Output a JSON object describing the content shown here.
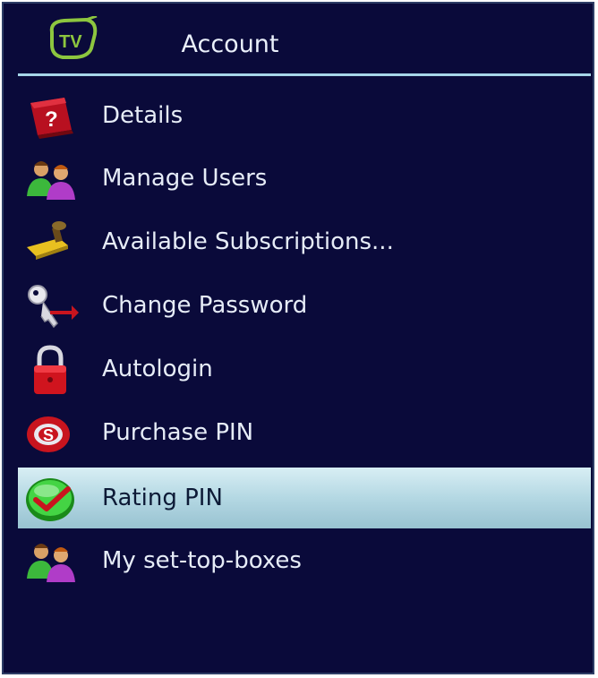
{
  "header": {
    "logo_text": "TV",
    "title": "Account"
  },
  "menu": {
    "selected_index": 6,
    "items": [
      {
        "label": "Details",
        "icon": "question-box-icon"
      },
      {
        "label": "Manage Users",
        "icon": "users-icon"
      },
      {
        "label": "Available Subscriptions...",
        "icon": "stamp-icon"
      },
      {
        "label": "Change Password",
        "icon": "key-icon"
      },
      {
        "label": "Autologin",
        "icon": "padlock-icon"
      },
      {
        "label": "Purchase PIN",
        "icon": "coin-icon"
      },
      {
        "label": "Rating PIN",
        "icon": "checkmark-icon"
      },
      {
        "label": "My set-top-boxes",
        "icon": "users-icon"
      }
    ]
  },
  "colors": {
    "background": "#0a0a3a",
    "divider": "#a6d6e8",
    "selection": "#b4d8e3",
    "logo_green": "#8dc63f"
  }
}
